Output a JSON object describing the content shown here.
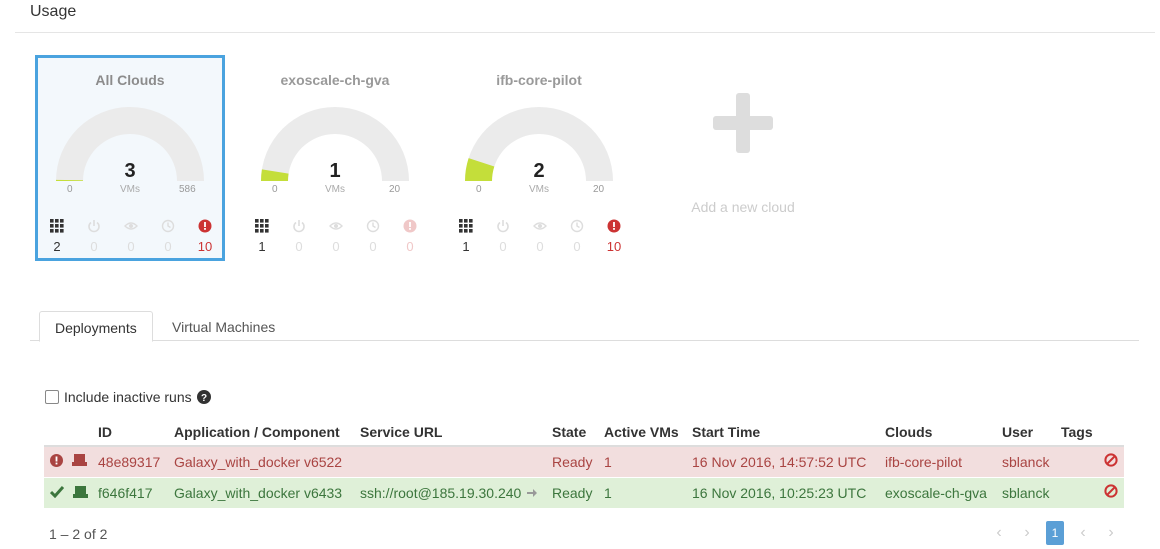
{
  "page": {
    "title": "Usage"
  },
  "colors": {
    "accent": "#4aa3df",
    "gauge_fill": "#c4de3a",
    "gauge_track": "#ebebeb",
    "error": "#c33",
    "success": "#3c763d"
  },
  "clouds": [
    {
      "name": "All Clouds",
      "value": "3",
      "unit": "VMs",
      "min": "0",
      "max": "586",
      "fill_fraction": 0.005,
      "stats": {
        "total": "2",
        "power": "0",
        "watching": "0",
        "pending": "0",
        "errors": "10"
      }
    },
    {
      "name": "exoscale-ch-gva",
      "value": "1",
      "unit": "VMs",
      "min": "0",
      "max": "20",
      "fill_fraction": 0.05,
      "stats": {
        "total": "1",
        "power": "0",
        "watching": "0",
        "pending": "0",
        "errors": "0"
      }
    },
    {
      "name": "ifb-core-pilot",
      "value": "2",
      "unit": "VMs",
      "min": "0",
      "max": "20",
      "fill_fraction": 0.1,
      "stats": {
        "total": "1",
        "power": "0",
        "watching": "0",
        "pending": "0",
        "errors": "10"
      }
    }
  ],
  "add_cloud": {
    "label": "Add a new cloud",
    "icon": "plus-icon"
  },
  "tabs": [
    {
      "label": "Deployments"
    },
    {
      "label": "Virtual Machines"
    }
  ],
  "filters": {
    "include_inactive_label": "Include inactive runs",
    "help_icon": "question-circle-icon"
  },
  "table": {
    "headers": [
      "ID",
      "Application / Component",
      "Service URL",
      "State",
      "Active VMs",
      "Start Time",
      "Clouds",
      "User",
      "Tags"
    ],
    "rows": [
      {
        "status": "error",
        "status_icon": "exclamation-circle-icon",
        "type_icon": "server-icon",
        "id": "48e89317",
        "app": "Galaxy_with_docker v6522",
        "url": "",
        "state": "Ready",
        "active_vms": "1",
        "start": "16 Nov 2016, 14:57:52 UTC",
        "cloud": "ifb-core-pilot",
        "user": "sblanck",
        "tags": ""
      },
      {
        "status": "ok",
        "status_icon": "check-icon",
        "type_icon": "server-icon",
        "id": "f646f417",
        "app": "Galaxy_with_docker v6433",
        "url": "ssh://root@185.19.30.240",
        "state": "Ready",
        "active_vms": "1",
        "start": "16 Nov 2016, 10:25:23 UTC",
        "cloud": "exoscale-ch-gva",
        "user": "sblanck",
        "tags": ""
      }
    ]
  },
  "pagination": {
    "summary": "1 – 2 of 2",
    "current_page": "1"
  }
}
